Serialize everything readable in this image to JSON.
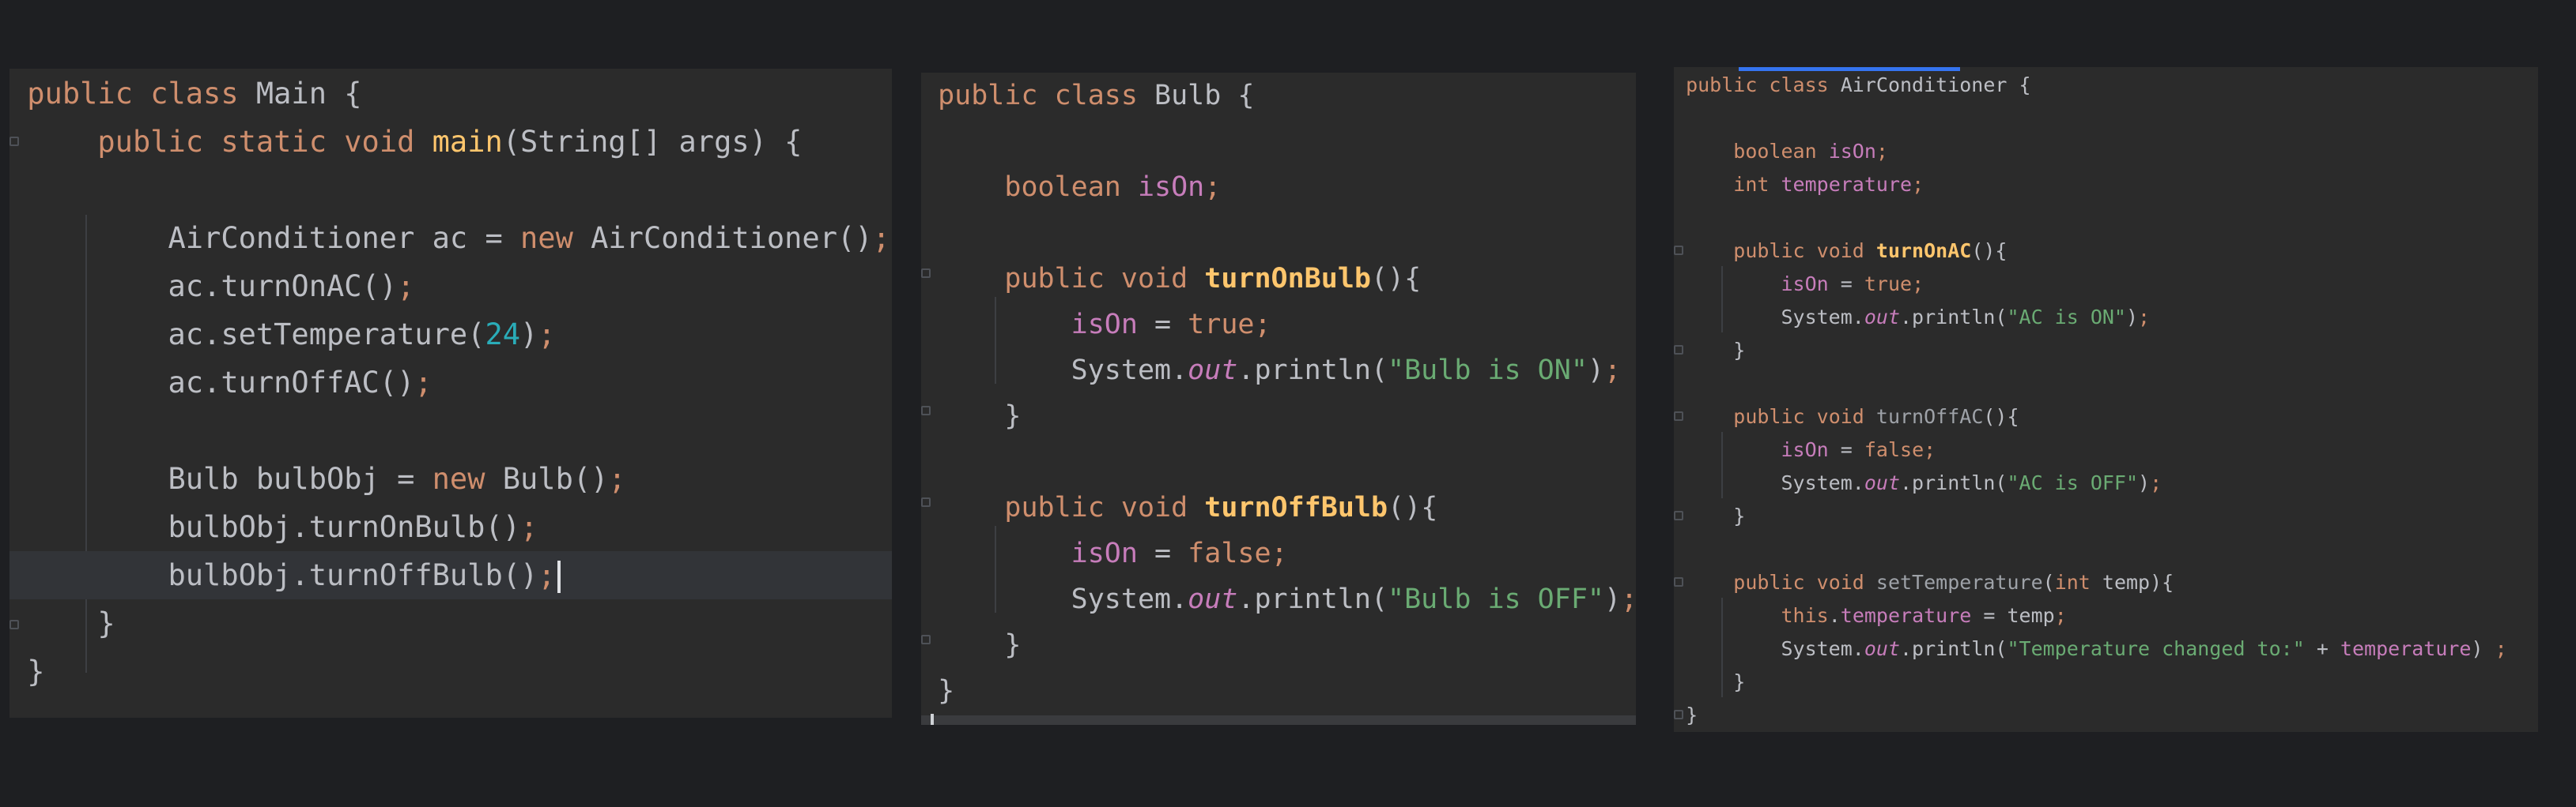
{
  "panels": {
    "main": {
      "lines": [
        [
          [
            "k",
            "public "
          ],
          [
            "k",
            "class "
          ],
          [
            "cn",
            "Main "
          ],
          [
            "p",
            "{"
          ]
        ],
        [
          [
            "p",
            "    "
          ],
          [
            "k",
            "public "
          ],
          [
            "k",
            "static "
          ],
          [
            "k",
            "void "
          ],
          [
            "mn",
            "main"
          ],
          [
            "p",
            "(String[] args) {"
          ]
        ],
        [],
        [
          [
            "p",
            "        AirConditioner ac = "
          ],
          [
            "k",
            "new "
          ],
          [
            "p",
            "AirConditioner()"
          ],
          [
            "k",
            ";"
          ]
        ],
        [
          [
            "p",
            "        ac.turnOnAC()"
          ],
          [
            "k",
            ";"
          ]
        ],
        [
          [
            "p",
            "        ac.setTemperature("
          ],
          [
            "n",
            "24"
          ],
          [
            "p",
            ")"
          ],
          [
            "k",
            ";"
          ]
        ],
        [
          [
            "p",
            "        ac.turnOffAC()"
          ],
          [
            "k",
            ";"
          ]
        ],
        [],
        [
          [
            "p",
            "        Bulb bulbObj = "
          ],
          [
            "k",
            "new "
          ],
          [
            "p",
            "Bulb()"
          ],
          [
            "k",
            ";"
          ]
        ],
        [
          [
            "p",
            "        bulbObj.turnOnBulb()"
          ],
          [
            "k",
            ";"
          ]
        ],
        [
          [
            "p",
            "        bulbObj.turnOffBulb()"
          ],
          [
            "k",
            ";"
          ]
        ],
        [
          [
            "p",
            "    }"
          ]
        ],
        [
          [
            "p",
            "}"
          ]
        ]
      ]
    },
    "bulb": {
      "lines": [
        [
          [
            "k",
            "public "
          ],
          [
            "k",
            "class "
          ],
          [
            "cn",
            "Bulb "
          ],
          [
            "p",
            "{"
          ]
        ],
        [],
        [
          [
            "p",
            "    "
          ],
          [
            "k",
            "boolean "
          ],
          [
            "fd",
            "isOn"
          ],
          [
            "k",
            ";"
          ]
        ],
        [],
        [
          [
            "p",
            "    "
          ],
          [
            "k",
            "public "
          ],
          [
            "k",
            "void "
          ],
          [
            "mb",
            "turnOnBulb"
          ],
          [
            "p",
            "(){"
          ]
        ],
        [
          [
            "p",
            "        "
          ],
          [
            "fd",
            "isOn "
          ],
          [
            "p",
            "= "
          ],
          [
            "k",
            "true"
          ],
          [
            "k",
            ";"
          ]
        ],
        [
          [
            "p",
            "        System."
          ],
          [
            "st",
            "out"
          ],
          [
            "p",
            ".println("
          ],
          [
            "s",
            "\"Bulb is ON\""
          ],
          [
            "p",
            ")"
          ],
          [
            "k",
            ";"
          ]
        ],
        [
          [
            "p",
            "    }"
          ]
        ],
        [],
        [
          [
            "p",
            "    "
          ],
          [
            "k",
            "public "
          ],
          [
            "k",
            "void "
          ],
          [
            "mb",
            "turnOffBulb"
          ],
          [
            "p",
            "(){"
          ]
        ],
        [
          [
            "p",
            "        "
          ],
          [
            "fd",
            "isOn "
          ],
          [
            "p",
            "= "
          ],
          [
            "k",
            "false"
          ],
          [
            "k",
            ";"
          ]
        ],
        [
          [
            "p",
            "        System."
          ],
          [
            "st",
            "out"
          ],
          [
            "p",
            ".println("
          ],
          [
            "s",
            "\"Bulb is OFF\""
          ],
          [
            "p",
            ")"
          ],
          [
            "k",
            ";"
          ]
        ],
        [
          [
            "p",
            "    }"
          ]
        ],
        [
          [
            "p",
            "}"
          ]
        ]
      ]
    },
    "ac": {
      "lines": [
        [
          [
            "k",
            "public "
          ],
          [
            "k",
            "class "
          ],
          [
            "cn",
            "AirConditioner "
          ],
          [
            "p",
            "{"
          ]
        ],
        [],
        [
          [
            "p",
            "    "
          ],
          [
            "k",
            "boolean "
          ],
          [
            "fd",
            "isOn"
          ],
          [
            "k",
            ";"
          ]
        ],
        [
          [
            "p",
            "    "
          ],
          [
            "k",
            "int "
          ],
          [
            "fd",
            "temperature"
          ],
          [
            "k",
            ";"
          ]
        ],
        [],
        [
          [
            "p",
            "    "
          ],
          [
            "k",
            "public "
          ],
          [
            "k",
            "void "
          ],
          [
            "mb",
            "turnOnAC"
          ],
          [
            "p",
            "(){"
          ]
        ],
        [
          [
            "p",
            "        "
          ],
          [
            "fd",
            "isOn "
          ],
          [
            "p",
            "= "
          ],
          [
            "k",
            "true"
          ],
          [
            "k",
            ";"
          ]
        ],
        [
          [
            "p",
            "        System."
          ],
          [
            "st",
            "out"
          ],
          [
            "p",
            ".println("
          ],
          [
            "s",
            "\"AC is ON\""
          ],
          [
            "p",
            ")"
          ],
          [
            "k",
            ";"
          ]
        ],
        [
          [
            "p",
            "    }"
          ]
        ],
        [],
        [
          [
            "p",
            "    "
          ],
          [
            "k",
            "public "
          ],
          [
            "k",
            "void "
          ],
          [
            "md",
            "turnOffAC"
          ],
          [
            "p",
            "(){"
          ]
        ],
        [
          [
            "p",
            "        "
          ],
          [
            "fd",
            "isOn "
          ],
          [
            "p",
            "= "
          ],
          [
            "k",
            "false"
          ],
          [
            "k",
            ";"
          ]
        ],
        [
          [
            "p",
            "        System."
          ],
          [
            "st",
            "out"
          ],
          [
            "p",
            ".println("
          ],
          [
            "s",
            "\"AC is OFF\""
          ],
          [
            "p",
            ")"
          ],
          [
            "k",
            ";"
          ]
        ],
        [
          [
            "p",
            "    }"
          ]
        ],
        [],
        [
          [
            "p",
            "    "
          ],
          [
            "k",
            "public "
          ],
          [
            "k",
            "void "
          ],
          [
            "md",
            "setTemperature"
          ],
          [
            "p",
            "("
          ],
          [
            "k",
            "int "
          ],
          [
            "p",
            "temp){"
          ]
        ],
        [
          [
            "p",
            "        "
          ],
          [
            "k",
            "this"
          ],
          [
            "p",
            "."
          ],
          [
            "fd",
            "temperature "
          ],
          [
            "p",
            "= temp"
          ],
          [
            "k",
            ";"
          ]
        ],
        [
          [
            "p",
            "        System."
          ],
          [
            "st",
            "out"
          ],
          [
            "p",
            ".println("
          ],
          [
            "s",
            "\"Temperature changed to:\""
          ],
          [
            "p",
            " + "
          ],
          [
            "fd",
            "temperature"
          ],
          [
            "p",
            ") "
          ],
          [
            "k",
            ";"
          ]
        ],
        [
          [
            "p",
            "    }"
          ]
        ],
        [
          [
            "p",
            "}"
          ]
        ]
      ]
    }
  },
  "colors": {
    "background": "#1e1f22",
    "editor": "#2b2b2b",
    "keyword": "#cf8e6d",
    "method": "#ffc66d",
    "field": "#c77dbb",
    "string": "#6aab73",
    "number": "#2aacb8",
    "text": "#bcbec4"
  }
}
